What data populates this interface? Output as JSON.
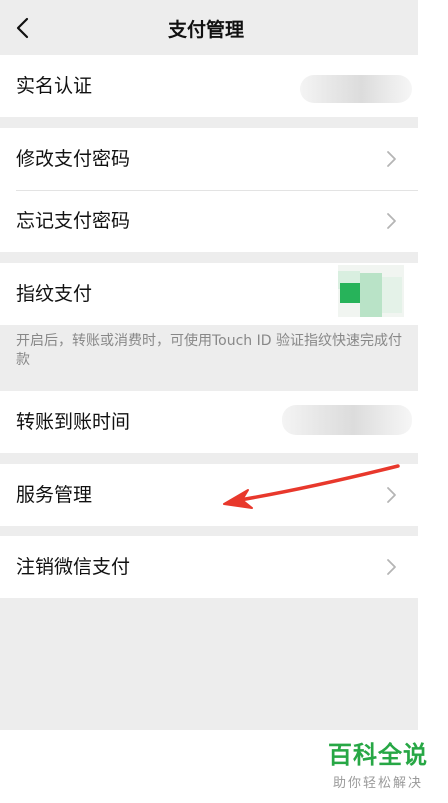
{
  "nav": {
    "title": "支付管理",
    "back_icon": "chevron-left-icon"
  },
  "rows": {
    "real_name": {
      "label": "实名认证"
    },
    "change_password": {
      "label": "修改支付密码",
      "icon": "chevron-right-icon"
    },
    "forgot_password": {
      "label": "忘记支付密码",
      "icon": "chevron-right-icon"
    },
    "fingerprint": {
      "label": "指纹支付",
      "hint": "开启后，转账或消费时，可使用Touch ID 验证指纹快速完成付款"
    },
    "transfer_time": {
      "label": "转账到账时间"
    },
    "service_manage": {
      "label": "服务管理",
      "icon": "chevron-right-icon"
    },
    "cancel_wechat_pay": {
      "label": "注销微信支付",
      "icon": "chevron-right-icon"
    }
  },
  "annotation": {
    "arrow_color": "#e8382c"
  },
  "watermark": {
    "title": "百科全说",
    "subtitle": "助你轻松解决"
  },
  "colors": {
    "background": "#ededed",
    "cell": "#ffffff",
    "text": "#111111",
    "hint": "#888888",
    "toggle_green": "#27b35a",
    "watermark_green": "#27a745"
  }
}
